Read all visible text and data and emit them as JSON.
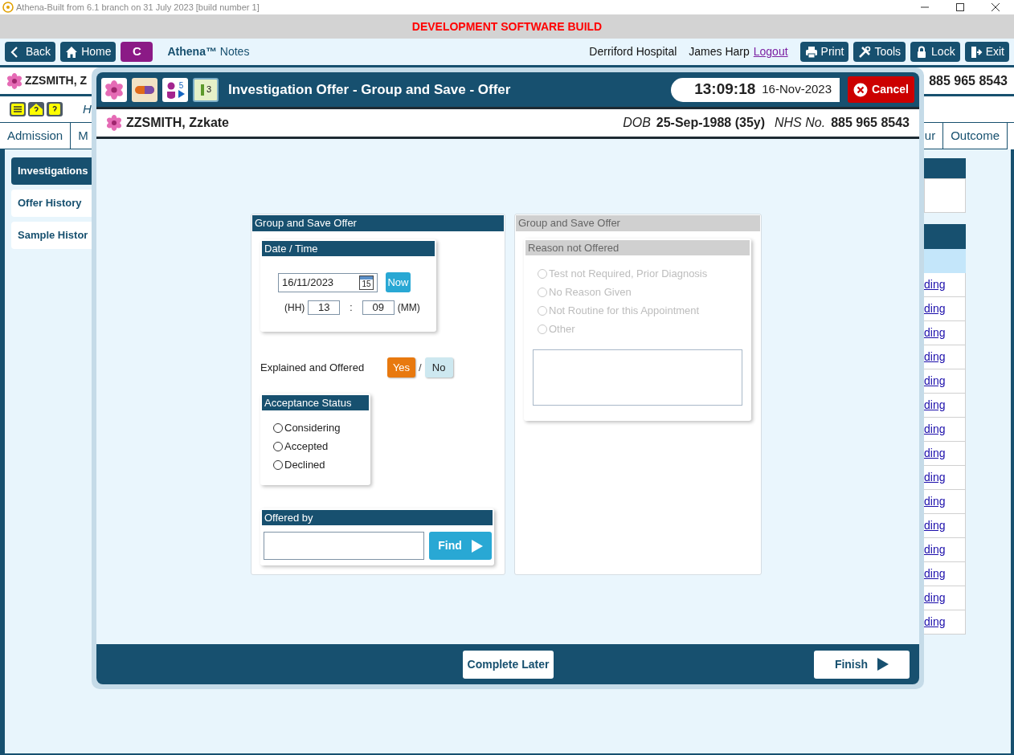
{
  "window": {
    "title": "Athena-Built from 6.1 branch on 31 July 2023 [build number 1]"
  },
  "banner": "DEVELOPMENT SOFTWARE BUILD",
  "toolbar": {
    "left_buttons": [
      {
        "label": "Back",
        "kind": "back"
      },
      {
        "label": "Home",
        "kind": "home"
      },
      {
        "label": "C",
        "kind": "letter"
      }
    ],
    "app_name": "Athena™",
    "app_suffix": "Notes",
    "hospital": "Derriford Hospital",
    "user": "James Harp",
    "logout": "Logout",
    "right_buttons": [
      {
        "label": "Print",
        "kind": "print"
      },
      {
        "label": "Tools",
        "kind": "tools"
      },
      {
        "label": "Lock",
        "kind": "lock"
      },
      {
        "label": "Exit",
        "kind": "exit"
      }
    ]
  },
  "patient_bar": {
    "name": "ZZSMITH, Z",
    "nhs": "885 965 8543"
  },
  "subbar": {
    "text": "H"
  },
  "tabs": [
    {
      "label": "Admission",
      "selected": false
    },
    {
      "label": "M",
      "selected": false
    },
    {
      "label": "ur",
      "selected": false
    },
    {
      "label": "Outcome",
      "selected": false
    }
  ],
  "sidebar": {
    "items": [
      {
        "label": "Investigations",
        "selected": true
      },
      {
        "label": "Offer History",
        "selected": false
      },
      {
        "label": "Sample Histor",
        "selected": false
      }
    ]
  },
  "table": {
    "rows": [
      {
        "link": "ding"
      },
      {
        "link": "ding"
      },
      {
        "link": "ding"
      },
      {
        "link": "ding"
      },
      {
        "link": "ding"
      },
      {
        "link": "ding"
      },
      {
        "link": "ding"
      },
      {
        "link": "ding"
      },
      {
        "link": "ding"
      },
      {
        "link": "ding"
      },
      {
        "link": "ding"
      },
      {
        "link": "ding"
      },
      {
        "link": "ding"
      },
      {
        "link": "ding"
      },
      {
        "link": "ding"
      }
    ]
  },
  "dialog": {
    "title": "Investigation Offer - Group and Save - Offer",
    "header_icons": [
      {
        "kind": "flower"
      },
      {
        "kind": "pill"
      },
      {
        "kind": "person",
        "badge": "5"
      },
      {
        "kind": "notepad",
        "badge": "3"
      }
    ],
    "time": "13:09:18",
    "date": "16-Nov-2023",
    "cancel": "Cancel",
    "patient": {
      "name": "ZZSMITH, Zzkate",
      "dob_label": "DOB",
      "dob": "25-Sep-1988 (35y)",
      "nhs_label": "NHS No.",
      "nhs": "885 965 8543"
    },
    "offer_panel": {
      "title": "Group and Save Offer",
      "date_time": {
        "title": "Date / Time",
        "date": "16/11/2023",
        "calendar_day": "15",
        "now": "Now",
        "hh_label": "(HH)",
        "hour": "13",
        "separator": ":",
        "minute": "09",
        "mm_label": "(MM)"
      },
      "explained": {
        "label": "Explained and Offered",
        "options": [
          {
            "label": "Yes",
            "selected": true
          },
          {
            "label": "No",
            "selected": false
          }
        ],
        "separator": "/"
      },
      "acceptance": {
        "title": "Acceptance Status",
        "options": [
          {
            "label": "Considering",
            "checked": false
          },
          {
            "label": "Accepted",
            "checked": false
          },
          {
            "label": "Declined",
            "checked": false
          }
        ]
      },
      "offered_by": {
        "title": "Offered by",
        "find": "Find"
      }
    },
    "reason_panel": {
      "title": "Group and Save Offer",
      "disabled": true,
      "reason": {
        "title": "Reason not Offered",
        "options": [
          {
            "label": "Test not Required, Prior Diagnosis",
            "checked": false
          },
          {
            "label": "No Reason Given",
            "checked": false
          },
          {
            "label": "Not Routine for this Appointment",
            "checked": false
          },
          {
            "label": "Other",
            "checked": false
          }
        ]
      }
    },
    "footer": {
      "complete_later": "Complete Later",
      "finish": "Finish"
    }
  }
}
